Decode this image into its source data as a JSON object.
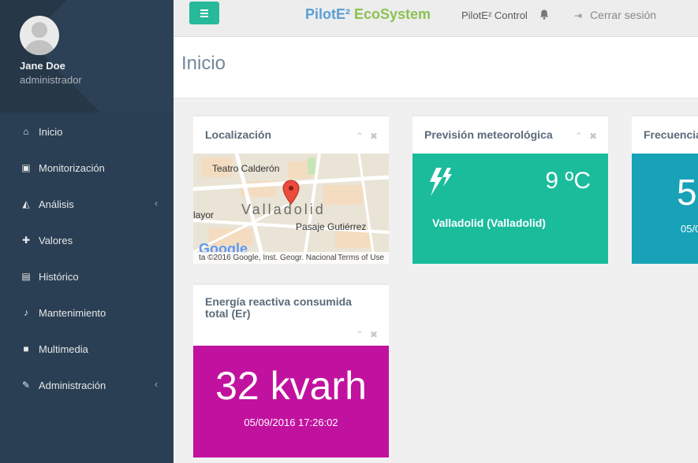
{
  "user": {
    "name": "Jane Doe",
    "role": "administrador"
  },
  "menu": [
    {
      "label": "Inicio",
      "icon": "home-icon",
      "glyph": "⌂",
      "submenu": false
    },
    {
      "label": "Monitorización",
      "icon": "monitor-icon",
      "glyph": "▣",
      "submenu": false
    },
    {
      "label": "Análisis",
      "icon": "area-chart-icon",
      "glyph": "◭",
      "submenu": true
    },
    {
      "label": "Valores",
      "icon": "puzzle-icon",
      "glyph": "✚",
      "submenu": false
    },
    {
      "label": "Histórico",
      "icon": "file-icon",
      "glyph": "▤",
      "submenu": false
    },
    {
      "label": "Mantenimiento",
      "icon": "bell-icon",
      "glyph": "♪",
      "submenu": false
    },
    {
      "label": "Multimedia",
      "icon": "video-camera-icon",
      "glyph": "■",
      "submenu": false
    },
    {
      "label": "Administración",
      "icon": "edit-icon",
      "glyph": "✎",
      "submenu": true
    }
  ],
  "chevron": "‹",
  "topnav": {
    "brand_part1": "PilotE² ",
    "brand_part2": "EcoSystem",
    "control_label": "PilotE² Control",
    "logout_label": "Cerrar sesión"
  },
  "page": {
    "title": "Inicio"
  },
  "panels": {
    "location": {
      "title": "Localización",
      "map": {
        "city": "Valladolid",
        "label_theatre": "Teatro Calderón",
        "label_mayor": "layor",
        "label_pasaje": "Pasaje Gutiérrez",
        "attribution": "ta ©2016 Google, Inst. Geogr. Nacional",
        "terms": "Terms of Use",
        "logo": "Google"
      }
    },
    "weather": {
      "title": "Previsión meteorológica",
      "temperature": "9 ºC",
      "location": "Valladolid (Valladolid)"
    },
    "frequency": {
      "title": "Frecuencia",
      "value": "5",
      "date": "05/0"
    },
    "reactive_energy": {
      "title": "Energía reactiva consumida total (Er)",
      "value": "32 kvarh",
      "date": "05/09/2016 17:26:02"
    }
  },
  "colors": {
    "sidebar": "#2a3f54",
    "toggle": "#26b99a",
    "weather": "#1abc9c",
    "frequency": "#17a2b8",
    "reactive_energy": "#c1119f",
    "brand_blue": "#5a9fd4",
    "brand_green": "#8cc152"
  }
}
